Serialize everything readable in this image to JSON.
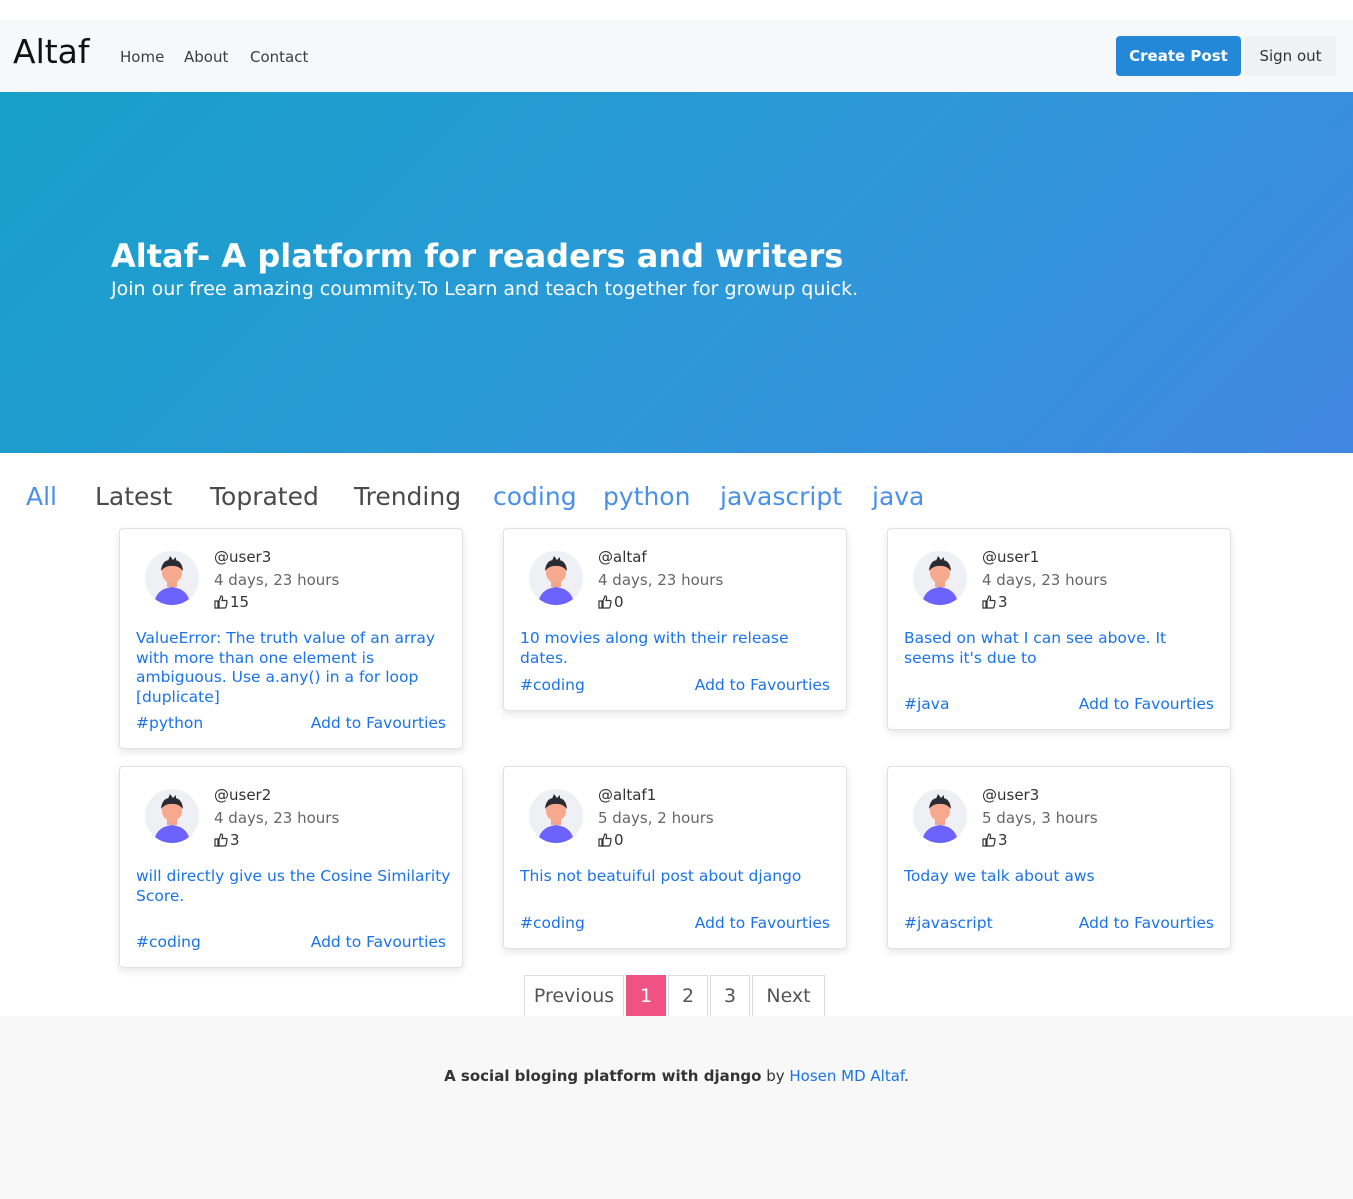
{
  "navbar": {
    "brand": "Altaf",
    "links": [
      "Home",
      "About",
      "Contact"
    ],
    "create_post": "Create Post",
    "sign_out": "Sign out"
  },
  "hero": {
    "title": "Altaf- A platform for readers and writers",
    "subtitle": "Join our free amazing coummity.To Learn and teach together for growup quick."
  },
  "filters": [
    "All",
    "Latest",
    "Toprated",
    "Trending",
    "coding",
    "python",
    "javascript",
    "java"
  ],
  "posts": [
    {
      "user": "@user3",
      "time": "4 days, 23 hours",
      "votes": "15",
      "title": "ValueError: The truth value of an array with more than one element is ambiguous. Use a.any() in a for loop [duplicate]",
      "tag": "#python",
      "fav": "Add to Favourties"
    },
    {
      "user": "@altaf",
      "time": "4 days, 23 hours",
      "votes": "0",
      "title": "10 movies along with their release dates.",
      "tag": "#coding",
      "fav": "Add to Favourties"
    },
    {
      "user": "@user1",
      "time": "4 days, 23 hours",
      "votes": "3",
      "title": "Based on what I can see above. It seems it's due to",
      "tag": "#java",
      "fav": "Add to Favourties"
    },
    {
      "user": "@user2",
      "time": "4 days, 23 hours",
      "votes": "3",
      "title": "will directly give us the Cosine Similarity Score.",
      "tag": "#coding",
      "fav": "Add to Favourties"
    },
    {
      "user": "@altaf1",
      "time": "5 days, 2 hours",
      "votes": "0",
      "title": "This not beatuiful post about django",
      "tag": "#coding",
      "fav": "Add to Favourties"
    },
    {
      "user": "@user3",
      "time": "5 days, 3 hours",
      "votes": "3",
      "title": "Today we talk about aws",
      "tag": "#javascript",
      "fav": "Add to Favourties"
    }
  ],
  "pagination": {
    "previous": "Previous",
    "pages": [
      "1",
      "2",
      "3"
    ],
    "current": "1",
    "next": "Next"
  },
  "footer": {
    "text_bold": "A social bloging platform with django",
    "by": " by ",
    "author": "Hosen MD Altaf",
    "end": "."
  },
  "colors": {
    "primary": "#2388d8",
    "link": "#1a73e8",
    "pagination_active": "#ee5384",
    "filter_active": "#4a90e8"
  },
  "icons": {
    "avatar": "user-avatar-icon",
    "votes": "thumbs-up-icon"
  }
}
